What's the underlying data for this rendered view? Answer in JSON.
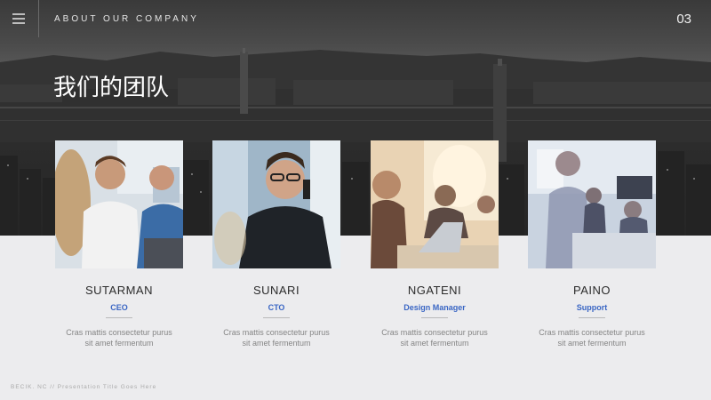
{
  "header": {
    "title": "ABOUT OUR COMPANY",
    "page_number": "03",
    "menu_icon": "hamburger-menu-icon"
  },
  "section": {
    "title": "我们的团队"
  },
  "team": [
    {
      "name": "SUTARMAN",
      "role": "CEO",
      "desc_line1": "Cras mattis consectetur purus",
      "desc_line2": "sit amet fermentum"
    },
    {
      "name": "SUNARI",
      "role": "CTO",
      "desc_line1": "Cras mattis consectetur purus",
      "desc_line2": "sit amet fermentum"
    },
    {
      "name": "NGATENI",
      "role": "Design Manager",
      "desc_line1": "Cras mattis consectetur purus",
      "desc_line2": "sit amet fermentum"
    },
    {
      "name": "PAINO",
      "role": "Support",
      "desc_line1": "Cras mattis consectetur purus",
      "desc_line2": "sit amet fermentum"
    }
  ],
  "footer": {
    "text": "BECIK. NC // Presentation Title Goes Here"
  },
  "colors": {
    "accent": "#3a66c4",
    "hero_dark": "#2c2c2c",
    "background": "#ececee"
  }
}
